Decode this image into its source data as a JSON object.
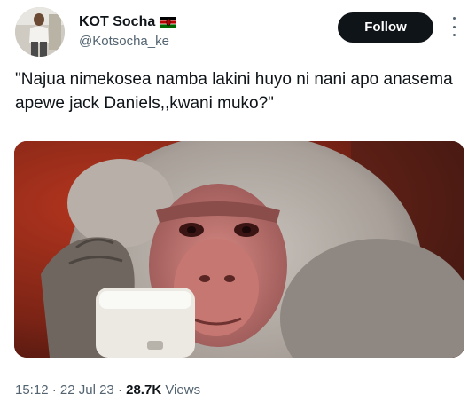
{
  "author": {
    "display_name": "KOT Socha",
    "handle": "@Kotsocha_ke",
    "flag_icon": "kenya-flag-icon"
  },
  "actions": {
    "follow_label": "Follow",
    "more_icon": "more-options-icon"
  },
  "tweet": {
    "text": "\"Najua nimekosea namba lakini huyo ni nani apo anasema apewe jack Daniels,,kwani muko?\""
  },
  "media": {
    "image_icon": "baboon-on-phone-image"
  },
  "meta": {
    "time": "15:12",
    "separator1": " · ",
    "date": "22 Jul 23",
    "separator2": " · ",
    "views_count": "28.7K",
    "views_label": " Views"
  },
  "colors": {
    "text_primary": "#0f1419",
    "text_secondary": "#536471",
    "follow_bg": "#0f1419",
    "follow_text": "#ffffff"
  }
}
